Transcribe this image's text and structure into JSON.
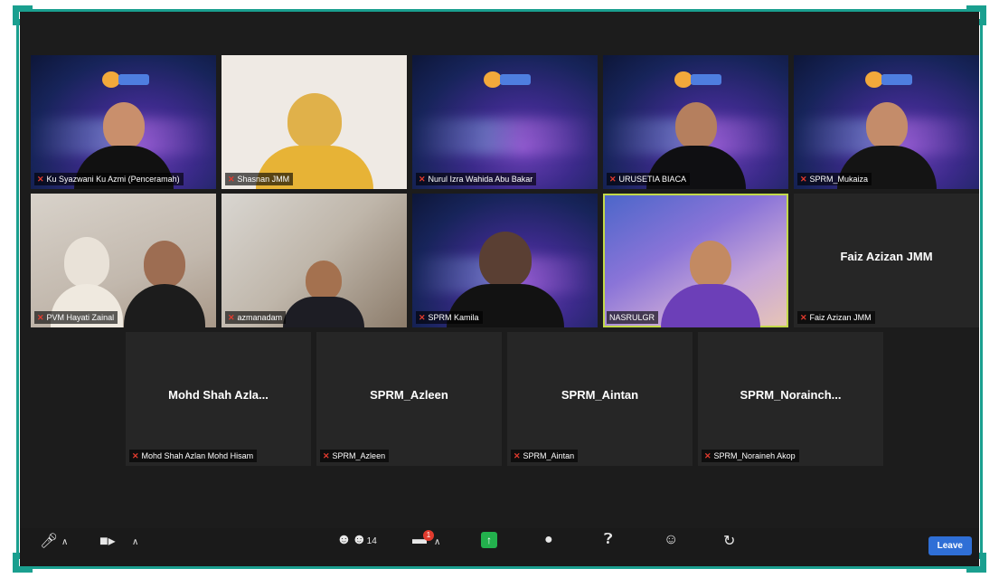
{
  "tiles_row1": [
    {
      "name": "Ku Syazwani Ku Azmi (Penceramah)",
      "bg": "brand"
    },
    {
      "name": "Shasnan JMM",
      "bg": "plain"
    },
    {
      "name": "Nurul Izra Wahida Abu Bakar",
      "bg": "brand"
    },
    {
      "name": "URUSETIA BIACA",
      "bg": "brand"
    },
    {
      "name": "SPRM_Mukaiza",
      "bg": "brand"
    }
  ],
  "tiles_row2": [
    {
      "name": "PVM Hayati Zainal",
      "bg": "room"
    },
    {
      "name": "azmanadam",
      "bg": "office"
    },
    {
      "name": "SPRM Kamila",
      "bg": "brand"
    },
    {
      "name": "NASRULGR",
      "bg": "stage"
    },
    {
      "name": "Faiz Azizan JMM",
      "bg": "dark",
      "display": "Faiz Azizan JMM"
    }
  ],
  "tiles_row3": [
    {
      "display": "Mohd Shah Azla...",
      "name": "Mohd Shah Azlan Mohd Hisam"
    },
    {
      "display": "SPRM_Azleen",
      "name": "SPRM_Azleen"
    },
    {
      "display": "SPRM_Aintan",
      "name": "SPRM_Aintan"
    },
    {
      "display": "SPRM_Norainch...",
      "name": "SPRM_Noraineh Akop"
    }
  ],
  "toolbar": {
    "participants_count": "14",
    "chat_badge": "1",
    "leave_label": "Leave"
  },
  "colors": {
    "frame": "#1a9f8f",
    "active_speaker": "#c3d94a",
    "mic_muted": "#e23b2e",
    "leave": "#2f6fd6"
  }
}
